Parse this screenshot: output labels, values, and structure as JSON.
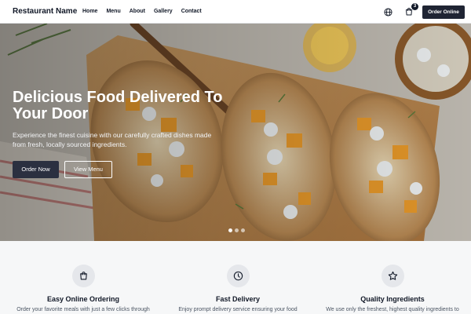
{
  "nav": {
    "brand": "Restaurant Name",
    "links": [
      "Home",
      "Menu",
      "About",
      "Gallery",
      "Contact"
    ],
    "cart_count": "3",
    "order_button": "Order Online"
  },
  "hero": {
    "title": "Delicious Food Delivered To Your Door",
    "subtitle": "Experience the finest cuisine with our carefully crafted dishes made from fresh, locally sourced ingredients.",
    "primary_button": "Order Now",
    "secondary_button": "View Menu",
    "slides": 3,
    "active_slide": 1
  },
  "features": [
    {
      "icon": "shopping-bag-icon",
      "title": "Easy Online Ordering",
      "desc": "Order your favorite meals with just a few clicks through"
    },
    {
      "icon": "clock-icon",
      "title": "Fast Delivery",
      "desc": "Enjoy prompt delivery service ensuring your food"
    },
    {
      "icon": "star-icon",
      "title": "Quality Ingredients",
      "desc": "We use only the freshest, highest quality ingredients to"
    }
  ],
  "colors": {
    "primary": "#1f2433",
    "feature_bg": "#f6f7f8",
    "icon_circle": "#e5e7eb"
  }
}
